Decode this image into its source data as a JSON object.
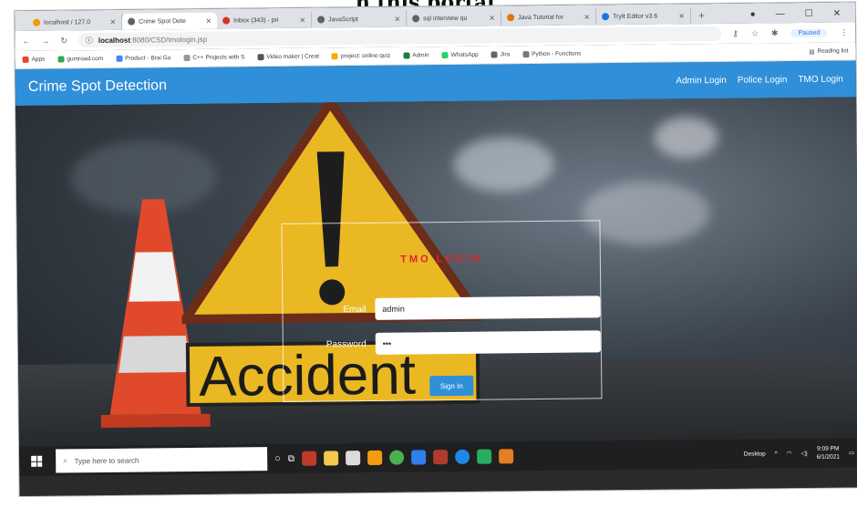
{
  "caption": "n this portal.",
  "browser": {
    "tabs": [
      {
        "label": "localhost / 127.0",
        "active": false
      },
      {
        "label": "Crime Spot Dete",
        "active": true
      },
      {
        "label": "Inbox (343) - pri",
        "active": false
      },
      {
        "label": "JavaScript",
        "active": false
      },
      {
        "label": "sql interview qu",
        "active": false
      },
      {
        "label": "Java Tutorial for",
        "active": false
      },
      {
        "label": "TryIt Editor v3.6",
        "active": false
      }
    ],
    "new_tab": "+",
    "address_host": "localhost",
    "address_path": ":8080/CSD/tmologin.jsp",
    "profile_status": "Paused",
    "bookmarks": [
      "Apps",
      "gumroad.com",
      "Product - Brai Go",
      "C++ Projects with S",
      "Video maker | Creat",
      "project: online quiz",
      "Admin",
      "WhatsApp",
      "Jira",
      "Python - Functions"
    ],
    "reading_list": "Reading list"
  },
  "app": {
    "brand": "Crime Spot Detection",
    "nav": [
      "Admin Login",
      "Police Login",
      "TMO Login"
    ]
  },
  "login": {
    "title": "TMO LOGIN",
    "email_label": "Email",
    "email_value": "admin",
    "password_label": "Password",
    "password_value": "•••",
    "submit": "Sign In"
  },
  "hero": {
    "sign_text": "Accident"
  },
  "taskbar": {
    "search_placeholder": "Type here to search",
    "desktop_label": "Desktop",
    "time": "9:09 PM",
    "date": "6/1/2021"
  }
}
